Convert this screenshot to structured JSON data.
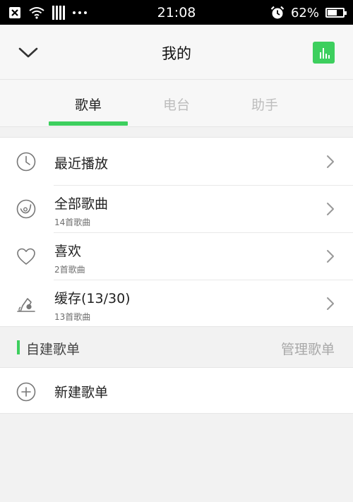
{
  "status_bar": {
    "time": "21:08",
    "battery_text": "62%",
    "battery_level": 0.62,
    "icons": [
      "close-box-icon",
      "wifi-icon",
      "signal-bars-icon",
      "more-dots-icon",
      "alarm-clock-icon",
      "battery-icon"
    ]
  },
  "header": {
    "title": "我的",
    "back_icon": "chevron-down-icon",
    "action_icon": "equalizer-icon"
  },
  "tabs": [
    {
      "label": "歌单",
      "active": true
    },
    {
      "label": "电台",
      "active": false
    },
    {
      "label": "助手",
      "active": false
    }
  ],
  "list": {
    "items": [
      {
        "title": "最近播放",
        "subtitle": "",
        "icon": "clock-icon"
      },
      {
        "title": "全部歌曲",
        "subtitle": "14首歌曲",
        "icon": "music-disc-icon"
      },
      {
        "title": "喜欢",
        "subtitle": "2首歌曲",
        "icon": "heart-icon"
      },
      {
        "title": "缓存(13/30)",
        "subtitle": "13首歌曲",
        "icon": "download-cache-icon"
      }
    ]
  },
  "section": {
    "title": "自建歌单",
    "manage_label": "管理歌单"
  },
  "new_playlist": {
    "label": "新建歌单",
    "icon": "plus-circle-icon"
  },
  "colors": {
    "accent": "#3dcf5e",
    "status_bar_bg": "#000000",
    "header_bg": "#f7f7f7",
    "page_bg": "#f2f2f2"
  }
}
